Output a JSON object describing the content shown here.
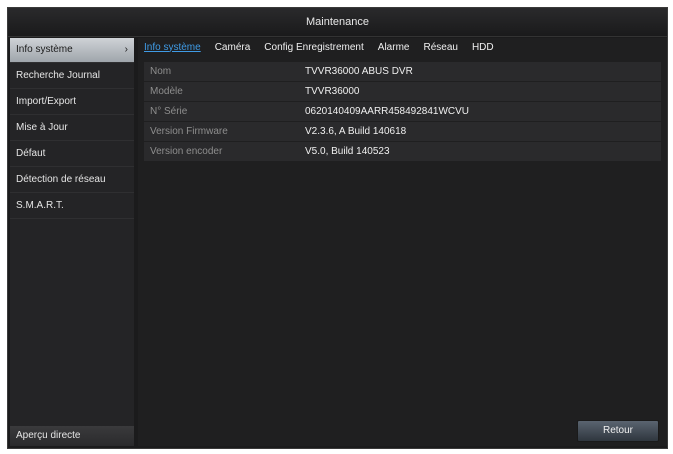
{
  "window": {
    "title": "Maintenance"
  },
  "sidebar": {
    "items": [
      {
        "label": "Info système",
        "active": true
      },
      {
        "label": "Recherche Journal"
      },
      {
        "label": "Import/Export"
      },
      {
        "label": "Mise à Jour"
      },
      {
        "label": "Défaut"
      },
      {
        "label": "Détection de réseau"
      },
      {
        "label": "S.M.A.R.T."
      }
    ],
    "active_chevron": "chevron-right-icon",
    "bottom_label": "Aperçu directe"
  },
  "tabs": [
    {
      "label": "Info système",
      "active": true
    },
    {
      "label": "Caméra"
    },
    {
      "label": "Config Enregistrement"
    },
    {
      "label": "Alarme"
    },
    {
      "label": "Réseau"
    },
    {
      "label": "HDD"
    }
  ],
  "info": {
    "rows": [
      {
        "label": "Nom",
        "value": "TVVR36000 ABUS DVR"
      },
      {
        "label": "Modèle",
        "value": "TVVR36000"
      },
      {
        "label": "N° Série",
        "value": "0620140409AARR458492841WCVU"
      },
      {
        "label": "Version Firmware",
        "value": "V2.3.6, A Build 140618"
      },
      {
        "label": "Version encoder",
        "value": "V5.0, Build 140523"
      }
    ]
  },
  "buttons": {
    "retour": "Retour"
  },
  "colors": {
    "background": "#1b1b1c",
    "active_tab": "#3f9be6",
    "row_bg": "#2a2a2c",
    "label_text": "#8e8e8e"
  }
}
